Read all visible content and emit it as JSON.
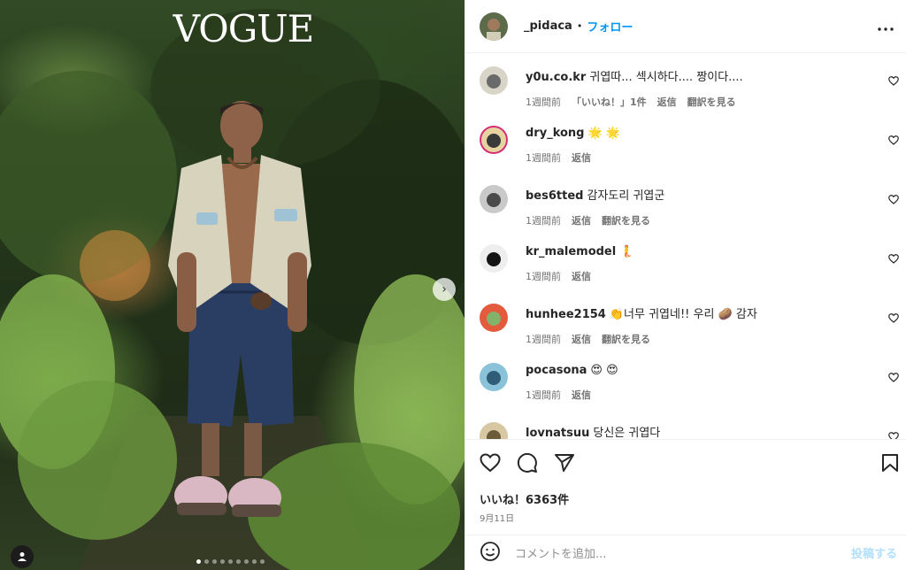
{
  "photo": {
    "magazine_logo": "VOGUE",
    "slide_count": 9,
    "active_slide": 1
  },
  "header": {
    "username": "_pidaca",
    "separator": "•",
    "follow_label": "フォロー",
    "more_icon": "more-horizontal-icon"
  },
  "comments": [
    {
      "user": "y0u.co.kr",
      "text": "귀엽따... 섹시하다.... 짱이다....",
      "time": "1週間前",
      "likes": "「いいね！」1件",
      "reply": "返信",
      "translate": "翻訳を見る",
      "avatar_colors": [
        "#d9d4c8",
        "#6a6a6a"
      ]
    },
    {
      "user": "dry_kong",
      "text": "🌟 🌟",
      "time": "1週間前",
      "reply": "返信",
      "avatar_colors": [
        "#e7d3a0",
        "#3a3a3a"
      ],
      "story_ring": true
    },
    {
      "user": "bes6tted",
      "text": "감자도리 귀엽군",
      "time": "1週間前",
      "reply": "返信",
      "translate": "翻訳を見る",
      "avatar_colors": [
        "#c9c9c9",
        "#4a4a4a"
      ]
    },
    {
      "user": "kr_malemodel",
      "text": "🧜",
      "time": "1週間前",
      "reply": "返信",
      "avatar_colors": [
        "#eeeeee",
        "#141414"
      ]
    },
    {
      "user": "hunhee2154",
      "text": "👏너무 귀엽네!! 우리 🥔 감자",
      "time": "1週間前",
      "reply": "返信",
      "translate": "翻訳を見る",
      "avatar_colors": [
        "#e35a3c",
        "#83b36a"
      ]
    },
    {
      "user": "pocasona",
      "text": "😍 😍",
      "time": "1週間前",
      "reply": "返信",
      "avatar_colors": [
        "#8ac3d9",
        "#2f5d77"
      ]
    },
    {
      "user": "lovnatsuu",
      "text": "당신은 귀엽다",
      "time": "",
      "reply": "",
      "avatar_colors": [
        "#d7c7a3",
        "#6b5b3a"
      ]
    }
  ],
  "actions": {
    "like_icon": "heart-icon",
    "comment_icon": "comment-icon",
    "share_icon": "send-icon",
    "save_icon": "bookmark-icon",
    "likes_text": "いいね！6363件",
    "date": "9月11日"
  },
  "add_comment": {
    "emoji_icon": "emoji-icon",
    "placeholder": "コメントを追加...",
    "post_label": "投稿する"
  },
  "colors": {
    "accent": "#0095f6",
    "post_disabled": "#b2dffc",
    "muted": "#737373"
  }
}
